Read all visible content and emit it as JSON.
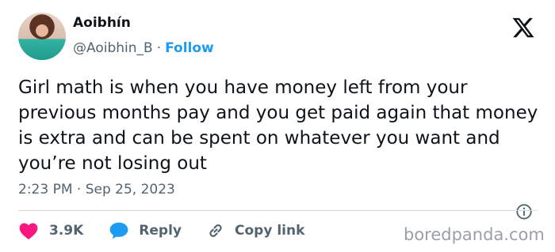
{
  "author": {
    "name": "Aoibhín",
    "handle": "@Aoibhin_B",
    "separator": "·",
    "follow_label": "Follow"
  },
  "tweet": {
    "text": "Girl math is when you have money left from your previous months pay and you get paid again that money is extra and can be spent on whatever you want and you’re not losing out",
    "time": "2:23 PM",
    "time_separator": "·",
    "date": "Sep 25, 2023"
  },
  "actions": {
    "likes_count": "3.9K",
    "reply_label": "Reply",
    "copy_link_label": "Copy link"
  },
  "watermark": "boredpanda.com",
  "icons": {
    "platform": "x-logo-icon",
    "like": "heart-icon",
    "reply": "speech-bubble-icon",
    "copy": "link-icon",
    "info": "info-icon"
  },
  "colors": {
    "follow": "#1d9bf0",
    "heart": "#f91880",
    "reply_bubble": "#1d9bf0",
    "secondary_text": "#536471"
  }
}
